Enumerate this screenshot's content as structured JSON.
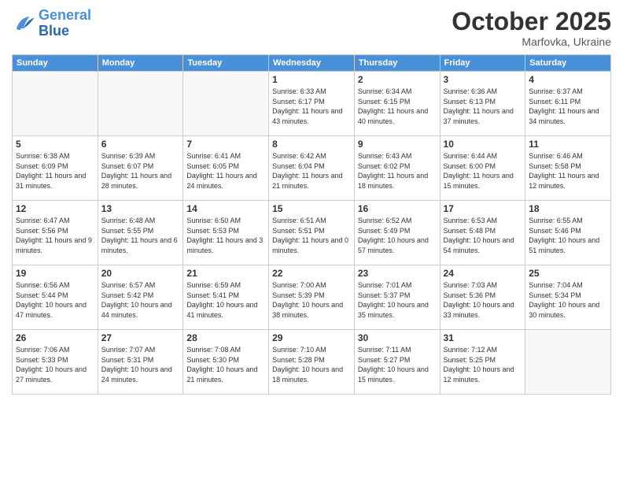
{
  "header": {
    "logo_text_general": "General",
    "logo_text_blue": "Blue",
    "month": "October 2025",
    "location": "Marfovka, Ukraine"
  },
  "days_of_week": [
    "Sunday",
    "Monday",
    "Tuesday",
    "Wednesday",
    "Thursday",
    "Friday",
    "Saturday"
  ],
  "weeks": [
    [
      {
        "day": "",
        "empty": true
      },
      {
        "day": "",
        "empty": true
      },
      {
        "day": "",
        "empty": true
      },
      {
        "day": "1",
        "info": "Sunrise: 6:33 AM\nSunset: 6:17 PM\nDaylight: 11 hours\nand 43 minutes."
      },
      {
        "day": "2",
        "info": "Sunrise: 6:34 AM\nSunset: 6:15 PM\nDaylight: 11 hours\nand 40 minutes."
      },
      {
        "day": "3",
        "info": "Sunrise: 6:36 AM\nSunset: 6:13 PM\nDaylight: 11 hours\nand 37 minutes."
      },
      {
        "day": "4",
        "info": "Sunrise: 6:37 AM\nSunset: 6:11 PM\nDaylight: 11 hours\nand 34 minutes."
      }
    ],
    [
      {
        "day": "5",
        "info": "Sunrise: 6:38 AM\nSunset: 6:09 PM\nDaylight: 11 hours\nand 31 minutes."
      },
      {
        "day": "6",
        "info": "Sunrise: 6:39 AM\nSunset: 6:07 PM\nDaylight: 11 hours\nand 28 minutes."
      },
      {
        "day": "7",
        "info": "Sunrise: 6:41 AM\nSunset: 6:05 PM\nDaylight: 11 hours\nand 24 minutes."
      },
      {
        "day": "8",
        "info": "Sunrise: 6:42 AM\nSunset: 6:04 PM\nDaylight: 11 hours\nand 21 minutes."
      },
      {
        "day": "9",
        "info": "Sunrise: 6:43 AM\nSunset: 6:02 PM\nDaylight: 11 hours\nand 18 minutes."
      },
      {
        "day": "10",
        "info": "Sunrise: 6:44 AM\nSunset: 6:00 PM\nDaylight: 11 hours\nand 15 minutes."
      },
      {
        "day": "11",
        "info": "Sunrise: 6:46 AM\nSunset: 5:58 PM\nDaylight: 11 hours\nand 12 minutes."
      }
    ],
    [
      {
        "day": "12",
        "info": "Sunrise: 6:47 AM\nSunset: 5:56 PM\nDaylight: 11 hours\nand 9 minutes."
      },
      {
        "day": "13",
        "info": "Sunrise: 6:48 AM\nSunset: 5:55 PM\nDaylight: 11 hours\nand 6 minutes."
      },
      {
        "day": "14",
        "info": "Sunrise: 6:50 AM\nSunset: 5:53 PM\nDaylight: 11 hours\nand 3 minutes."
      },
      {
        "day": "15",
        "info": "Sunrise: 6:51 AM\nSunset: 5:51 PM\nDaylight: 11 hours\nand 0 minutes."
      },
      {
        "day": "16",
        "info": "Sunrise: 6:52 AM\nSunset: 5:49 PM\nDaylight: 10 hours\nand 57 minutes."
      },
      {
        "day": "17",
        "info": "Sunrise: 6:53 AM\nSunset: 5:48 PM\nDaylight: 10 hours\nand 54 minutes."
      },
      {
        "day": "18",
        "info": "Sunrise: 6:55 AM\nSunset: 5:46 PM\nDaylight: 10 hours\nand 51 minutes."
      }
    ],
    [
      {
        "day": "19",
        "info": "Sunrise: 6:56 AM\nSunset: 5:44 PM\nDaylight: 10 hours\nand 47 minutes."
      },
      {
        "day": "20",
        "info": "Sunrise: 6:57 AM\nSunset: 5:42 PM\nDaylight: 10 hours\nand 44 minutes."
      },
      {
        "day": "21",
        "info": "Sunrise: 6:59 AM\nSunset: 5:41 PM\nDaylight: 10 hours\nand 41 minutes."
      },
      {
        "day": "22",
        "info": "Sunrise: 7:00 AM\nSunset: 5:39 PM\nDaylight: 10 hours\nand 38 minutes."
      },
      {
        "day": "23",
        "info": "Sunrise: 7:01 AM\nSunset: 5:37 PM\nDaylight: 10 hours\nand 35 minutes."
      },
      {
        "day": "24",
        "info": "Sunrise: 7:03 AM\nSunset: 5:36 PM\nDaylight: 10 hours\nand 33 minutes."
      },
      {
        "day": "25",
        "info": "Sunrise: 7:04 AM\nSunset: 5:34 PM\nDaylight: 10 hours\nand 30 minutes."
      }
    ],
    [
      {
        "day": "26",
        "info": "Sunrise: 7:06 AM\nSunset: 5:33 PM\nDaylight: 10 hours\nand 27 minutes."
      },
      {
        "day": "27",
        "info": "Sunrise: 7:07 AM\nSunset: 5:31 PM\nDaylight: 10 hours\nand 24 minutes."
      },
      {
        "day": "28",
        "info": "Sunrise: 7:08 AM\nSunset: 5:30 PM\nDaylight: 10 hours\nand 21 minutes."
      },
      {
        "day": "29",
        "info": "Sunrise: 7:10 AM\nSunset: 5:28 PM\nDaylight: 10 hours\nand 18 minutes."
      },
      {
        "day": "30",
        "info": "Sunrise: 7:11 AM\nSunset: 5:27 PM\nDaylight: 10 hours\nand 15 minutes."
      },
      {
        "day": "31",
        "info": "Sunrise: 7:12 AM\nSunset: 5:25 PM\nDaylight: 10 hours\nand 12 minutes."
      },
      {
        "day": "",
        "empty": true
      }
    ]
  ]
}
